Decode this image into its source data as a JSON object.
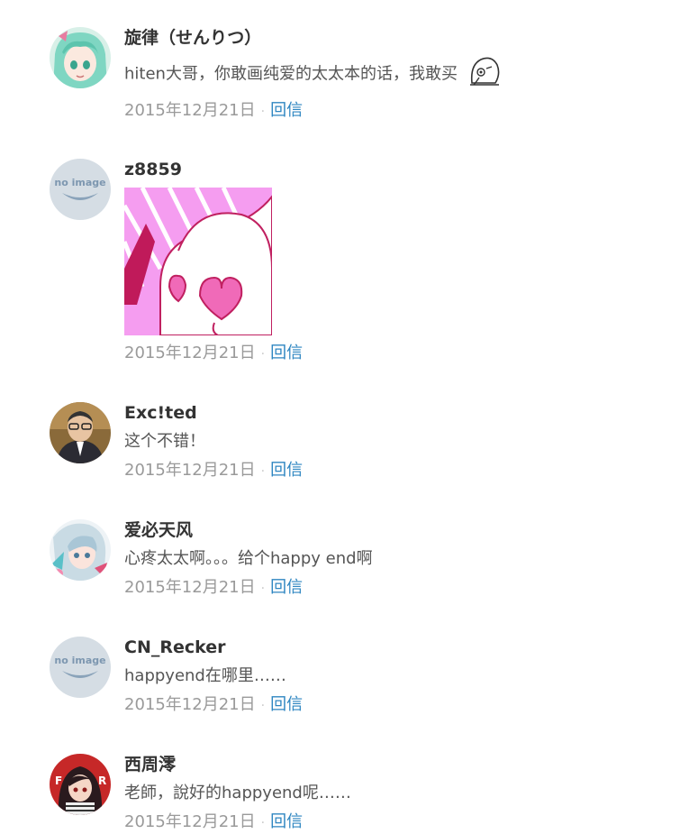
{
  "comments": [
    {
      "name": "旋律（せんりつ）",
      "text": "hiten大哥，你敢画纯爱的太太本的话，我敢买",
      "date": "2015年12月21日",
      "reply": "回信",
      "avatar": "anime-teal-hair",
      "sticker": "crying-face-sticker"
    },
    {
      "name": "z8859",
      "text": "",
      "date": "2015年12月21日",
      "reply": "回信",
      "avatar": "no-image",
      "image": "heart-eyes-sticker"
    },
    {
      "name": "Exc!ted",
      "text": "这个不错！",
      "date": "2015年12月21日",
      "reply": "回信",
      "avatar": "photo-man-glasses"
    },
    {
      "name": "爱必天风",
      "text": "心疼太太啊。。。给个happy end啊",
      "date": "2015年12月21日",
      "reply": "回信",
      "avatar": "anime-silver-hair"
    },
    {
      "name": "CN_Recker",
      "text": "happyend在哪里……",
      "date": "2015年12月21日",
      "reply": "回信",
      "avatar": "no-image"
    },
    {
      "name": "西周澪",
      "text": "老師，說好的happyend呢……",
      "date": "2015年12月21日",
      "reply": "回信",
      "avatar": "anime-red-dark"
    }
  ],
  "no_image_label": "no image",
  "colors": {
    "reply": "#2e86c1",
    "name": "#333333",
    "meta": "#9a9a9a"
  }
}
